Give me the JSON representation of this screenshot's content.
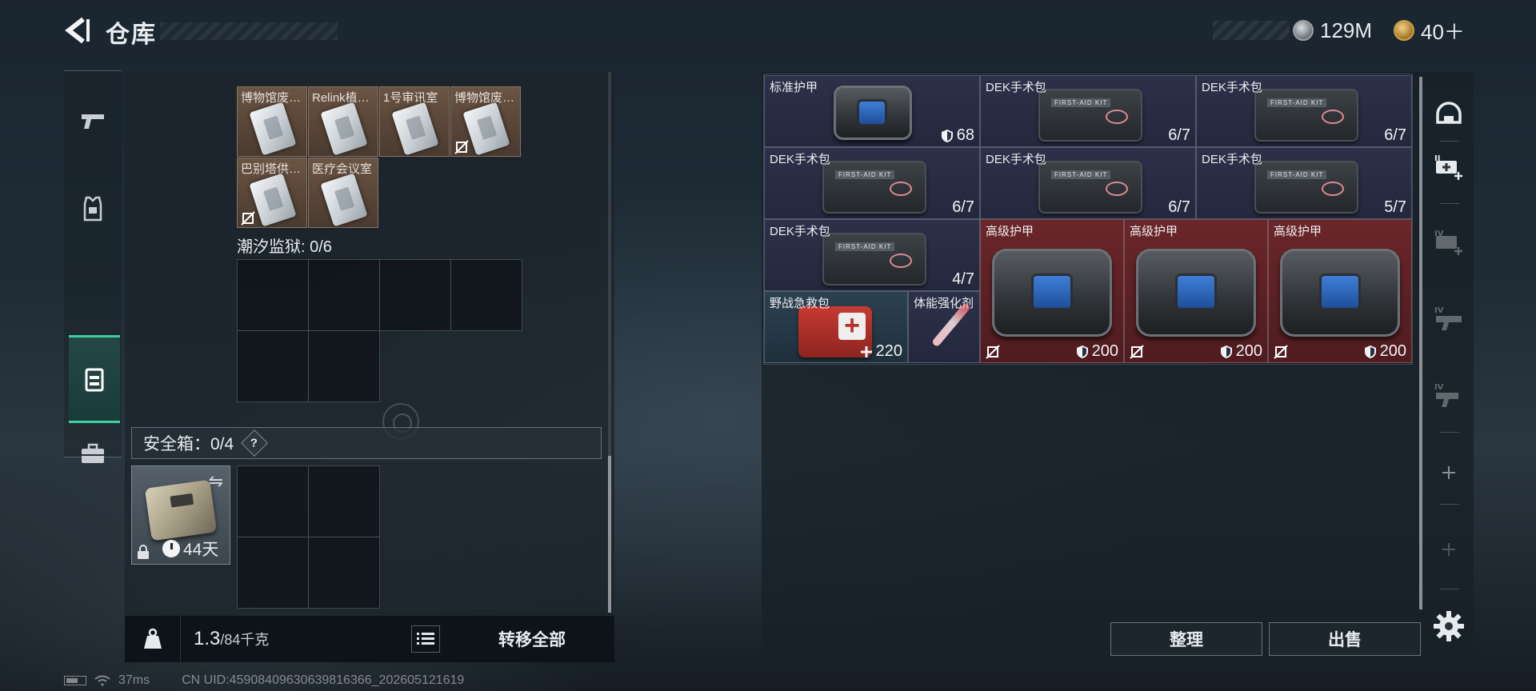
{
  "header": {
    "title": "仓库",
    "money": "129M",
    "tickets": "40＋"
  },
  "left_tabs": [
    {
      "name": "weapons",
      "icon": "pistol-icon"
    },
    {
      "name": "armor",
      "icon": "vest-icon"
    },
    {
      "name": "equipment",
      "icon": "backpack-icon",
      "active": true
    },
    {
      "name": "supplies",
      "icon": "toolbox-icon"
    }
  ],
  "keycards": {
    "items": [
      {
        "label": "博物馆废…",
        "no_trade": false
      },
      {
        "label": "Relink植…",
        "no_trade": false
      },
      {
        "label": "1号审讯室",
        "no_trade": false
      },
      {
        "label": "博物馆废…",
        "no_trade": true
      },
      {
        "label": "巴别塔供…",
        "no_trade": true
      },
      {
        "label": "医疗会议室",
        "no_trade": false
      }
    ]
  },
  "prison": {
    "label": "潮汐监狱: 0/6"
  },
  "safe": {
    "label": "安全箱：0/4",
    "help": "?",
    "swap": "⇋",
    "duration": "44天"
  },
  "footer": {
    "weight": "1.3",
    "weight_max": "/84千克",
    "transfer_all": "转移全部"
  },
  "status": {
    "ping": "37ms",
    "uid": "CN UID:459084096306398163​66_202605121619"
  },
  "stash": [
    {
      "name": "标准护甲",
      "value": "68",
      "kind": "armor-small",
      "color": "navy",
      "stat_icon": "shield-icon",
      "no_trade": false
    },
    {
      "name": "DEK手术包",
      "value": "6/7",
      "kind": "kit",
      "color": "navy",
      "stat_icon": "",
      "no_trade": false
    },
    {
      "name": "DEK手术包",
      "value": "6/7",
      "kind": "kit",
      "color": "navy",
      "stat_icon": "",
      "no_trade": false
    },
    {
      "name": "DEK手术包",
      "value": "6/7",
      "kind": "kit",
      "color": "navy",
      "stat_icon": "",
      "no_trade": false
    },
    {
      "name": "DEK手术包",
      "value": "6/7",
      "kind": "kit",
      "color": "navy",
      "stat_icon": "",
      "no_trade": false
    },
    {
      "name": "DEK手术包",
      "value": "5/7",
      "kind": "kit",
      "color": "navy",
      "stat_icon": "",
      "no_trade": false
    },
    {
      "name": "DEK手术包",
      "value": "4/7",
      "kind": "kit",
      "color": "navy",
      "stat_icon": "",
      "no_trade": false
    },
    {
      "name": "高级护甲",
      "value": "200",
      "kind": "armor",
      "color": "red",
      "stat_icon": "shield-icon",
      "no_trade": true
    },
    {
      "name": "高级护甲",
      "value": "200",
      "kind": "armor",
      "color": "red",
      "stat_icon": "shield-icon",
      "no_trade": true
    },
    {
      "name": "高级护甲",
      "value": "200",
      "kind": "armor",
      "color": "red",
      "stat_icon": "shield-icon",
      "no_trade": true
    },
    {
      "name": "野战急救包",
      "value": "220",
      "kind": "medkit",
      "color": "teal",
      "stat_icon": "plus-icon",
      "no_trade": false
    },
    {
      "name": "体能强化剂",
      "value": "",
      "kind": "syringe",
      "color": "navy",
      "stat_icon": "",
      "no_trade": false
    }
  ],
  "right_tools": [
    {
      "name": "helmet-tab",
      "icon": "helmet-icon"
    },
    {
      "name": "add-medkit-tab",
      "icon": "medkit-plus-icon"
    },
    {
      "name": "add-medkit-iv-tab",
      "icon": "medkit-iv-icon"
    },
    {
      "name": "iv-equipment-tab",
      "icon": "iv-icon"
    },
    {
      "name": "iv-gear-tab",
      "icon": "iv-gear-icon"
    },
    {
      "name": "add-tab-1",
      "icon": "plus-icon"
    },
    {
      "name": "add-tab-2",
      "icon": "plus-icon"
    }
  ],
  "actions": {
    "sort": "整理",
    "sell": "出售"
  },
  "colors": {
    "accent": "#3ed0a0",
    "navy_cell": "#2c3149",
    "red_cell": "#6b2629"
  }
}
